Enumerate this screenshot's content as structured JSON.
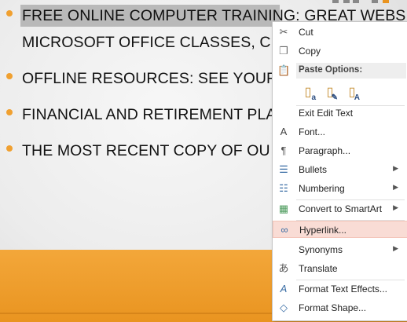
{
  "slide": {
    "bullets": [
      {
        "text": "FREE ONLINE COMPUTER TRAINING: GREAT WEBSI"
      },
      {
        "text": "MICROSOFT OFFICE CLASSES,  C"
      },
      {
        "text": "OFFLINE RESOURCES: SEE YOUR"
      },
      {
        "text": "FINANCIAL AND RETIREMENT PLA"
      },
      {
        "text": "THE MOST RECENT COPY OF OU"
      }
    ],
    "accent_color": "#f0a030"
  },
  "context_menu": {
    "cut": "Cut",
    "copy": "Copy",
    "paste_options_header": "Paste Options:",
    "paste_options": [
      {
        "icon": "paste-keep-source-icon",
        "sub": "a"
      },
      {
        "icon": "paste-merge-format-icon",
        "sub": "✎"
      },
      {
        "icon": "paste-text-only-icon",
        "sub": "A"
      }
    ],
    "exit_edit_text": "Exit Edit Text",
    "font": "Font...",
    "paragraph": "Paragraph...",
    "bullets": "Bullets",
    "numbering": "Numbering",
    "convert_smartart": "Convert to SmartArt",
    "hyperlink": "Hyperlink...",
    "synonyms": "Synonyms",
    "translate": "Translate",
    "format_text_effects": "Format Text Effects...",
    "format_shape": "Format Shape...",
    "highlight_color": "#f9dcd5"
  }
}
